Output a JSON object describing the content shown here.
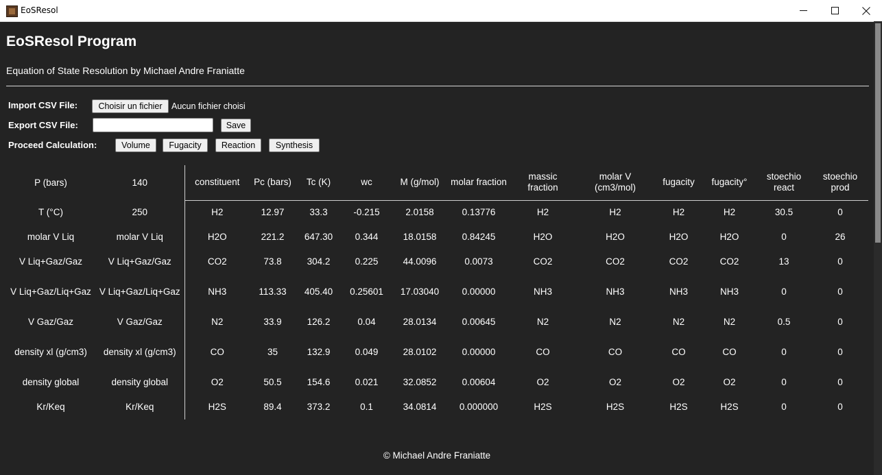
{
  "window": {
    "title": "EoSResol",
    "controls": {
      "minimize": "minimize",
      "maximize": "maximize",
      "close": "close"
    }
  },
  "header": {
    "title": "EoSResol Program",
    "subtitle": "Equation of State Resolution by Michael Andre Franiatte"
  },
  "import": {
    "label": "Import CSV File:",
    "button": "Choisir un fichier",
    "status": "Aucun fichier choisi"
  },
  "export": {
    "label": "Export CSV File:",
    "input_value": "",
    "save_button": "Save"
  },
  "calculation": {
    "label": "Proceed Calculation:",
    "buttons": [
      "Volume",
      "Fugacity",
      "Reaction",
      "Synthesis"
    ]
  },
  "conditions": [
    {
      "name": "P (bars)",
      "value": "140"
    },
    {
      "name": "T (°C)",
      "value": "250"
    },
    {
      "name": "molar V Liq",
      "value": "molar V Liq"
    },
    {
      "name": "V Liq+Gaz/Gaz",
      "value": "V Liq+Gaz/Gaz"
    },
    {
      "name": "V Liq+Gaz/Liq+Gaz",
      "value": "V Liq+Gaz/Liq+Gaz"
    },
    {
      "name": "V Gaz/Gaz",
      "value": "V Gaz/Gaz"
    },
    {
      "name": "density xl (g/cm3)",
      "value": "density xl (g/cm3)"
    },
    {
      "name": "density global",
      "value": "density global"
    },
    {
      "name": "Kr/Keq",
      "value": "Kr/Keq"
    }
  ],
  "components": {
    "headers": [
      "constituent",
      "Pc (bars)",
      "Tc (K)",
      "wc",
      "M (g/mol)",
      "molar fraction",
      "massic fraction",
      "molar V (cm3/mol)",
      "fugacity",
      "fugacity°",
      "stoechio react",
      "stoechio prod"
    ],
    "rows": [
      [
        "H2",
        "12.97",
        "33.3",
        "-0.215",
        "2.0158",
        "0.13776",
        "H2",
        "H2",
        "H2",
        "H2",
        "30.5",
        "0"
      ],
      [
        "H2O",
        "221.2",
        "647.30",
        "0.344",
        "18.0158",
        "0.84245",
        "H2O",
        "H2O",
        "H2O",
        "H2O",
        "0",
        "26"
      ],
      [
        "CO2",
        "73.8",
        "304.2",
        "0.225",
        "44.0096",
        "0.0073",
        "CO2",
        "CO2",
        "CO2",
        "CO2",
        "13",
        "0"
      ],
      [
        "NH3",
        "113.33",
        "405.40",
        "0.25601",
        "17.03040",
        "0.00000",
        "NH3",
        "NH3",
        "NH3",
        "NH3",
        "0",
        "0"
      ],
      [
        "N2",
        "33.9",
        "126.2",
        "0.04",
        "28.0134",
        "0.00645",
        "N2",
        "N2",
        "N2",
        "N2",
        "0.5",
        "0"
      ],
      [
        "CO",
        "35",
        "132.9",
        "0.049",
        "28.0102",
        "0.00000",
        "CO",
        "CO",
        "CO",
        "CO",
        "0",
        "0"
      ],
      [
        "O2",
        "50.5",
        "154.6",
        "0.021",
        "32.0852",
        "0.00604",
        "O2",
        "O2",
        "O2",
        "O2",
        "0",
        "0"
      ],
      [
        "H2S",
        "89.4",
        "373.2",
        "0.1",
        "34.0814",
        "0.000000",
        "H2S",
        "H2S",
        "H2S",
        "H2S",
        "0",
        "0"
      ]
    ]
  },
  "footer": "© Michael Andre Franiatte"
}
